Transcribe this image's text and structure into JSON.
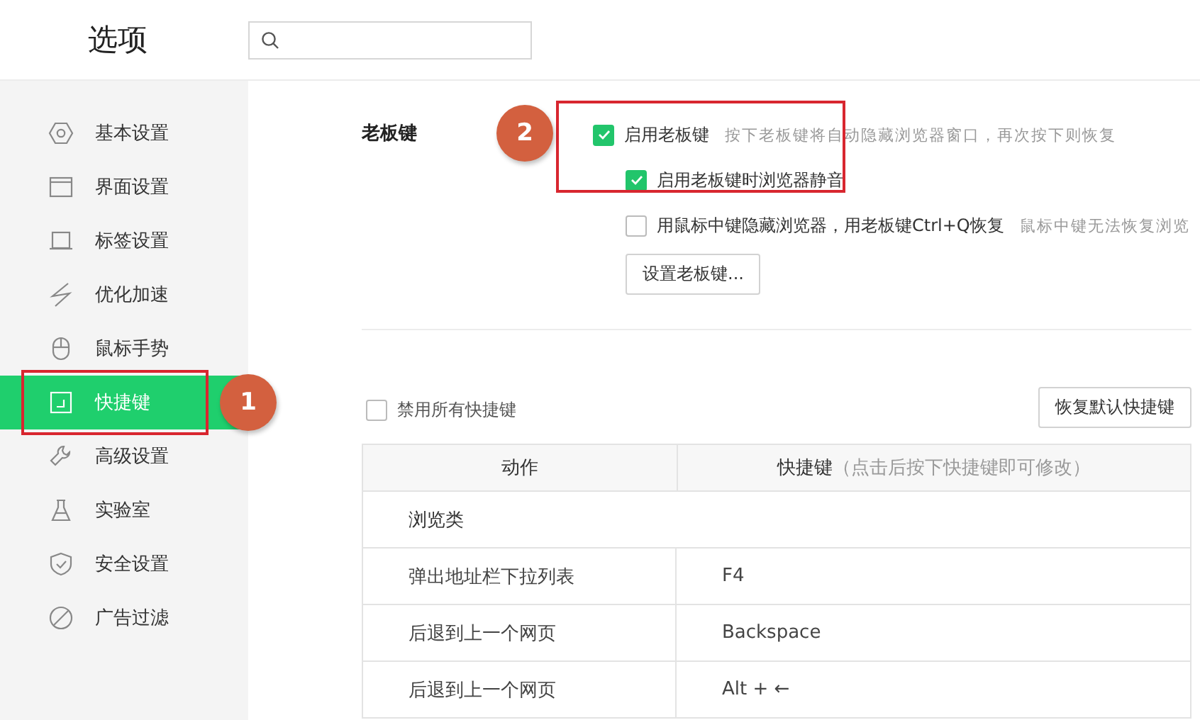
{
  "window": {
    "title": "选项"
  },
  "sidebar": {
    "items": [
      {
        "label": "基本设置",
        "selected": false
      },
      {
        "label": "界面设置",
        "selected": false
      },
      {
        "label": "标签设置",
        "selected": false
      },
      {
        "label": "优化加速",
        "selected": false
      },
      {
        "label": "鼠标手势",
        "selected": false
      },
      {
        "label": "快捷键",
        "selected": true
      },
      {
        "label": "高级设置",
        "selected": false
      },
      {
        "label": "实验室",
        "selected": false
      },
      {
        "label": "安全设置",
        "selected": false
      },
      {
        "label": "广告过滤",
        "selected": false
      }
    ]
  },
  "boss_key": {
    "label": "老板键",
    "option": {
      "label": "启用老板键",
      "hint": "按下老板键将自动隐藏浏览器窗口，再次按下则恢复",
      "checked": true,
      "children": [
        {
          "label": "启用老板键时浏览器静音",
          "checked": true
        },
        {
          "label": "用鼠标中键隐藏浏览器，用老板键Ctrl+Q恢复",
          "hint": "鼠标中键无法恢复浏览",
          "checked": false
        }
      ]
    },
    "button": "设置老板键..."
  },
  "shortcuts": {
    "disable_all": {
      "label": "禁用所有快捷键",
      "checked": false
    },
    "reset_button": "恢复默认快捷键",
    "table": {
      "columns": [
        {
          "label": "动作"
        },
        {
          "label": "快捷键",
          "hint": "（点击后按下快捷键即可修改）"
        }
      ],
      "rows": [
        {
          "kind": "category",
          "action": "浏览类"
        },
        {
          "kind": "shortcut",
          "action": "弹出地址栏下拉列表",
          "key": "F4"
        },
        {
          "kind": "shortcut",
          "action": "后退到上一个网页",
          "key": "Backspace"
        },
        {
          "kind": "shortcut",
          "action": "后退到上一个网页",
          "key": "Alt + ←"
        }
      ]
    }
  },
  "annotations": [
    {
      "label": "1"
    },
    {
      "label": "2"
    }
  ]
}
